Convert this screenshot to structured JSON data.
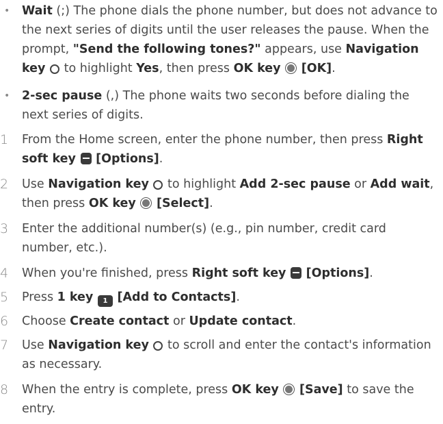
{
  "bullets": [
    {
      "term": "Wait",
      "t1": " (;) The phone dials the phone number, but does not advance to the next series of digits until the user releases the pause. When the prompt, ",
      "prompt": "\"Send the following tones?\"",
      "t2": " appears, use ",
      "nav_key": "Navigation key",
      "t3": " to highlight ",
      "yes": "Yes",
      "t4": ", then press ",
      "ok_key": "OK key",
      "ok_action": "[OK]",
      "t5": "."
    },
    {
      "term": "2-sec pause",
      "t1": " (,) The phone waits two seconds before dialing the next series of digits."
    }
  ],
  "steps": {
    "s1": {
      "num": "1",
      "t1": "From the Home screen, enter the phone number, then press ",
      "key": "Right soft key",
      "action": "[Options]",
      "t2": "."
    },
    "s2": {
      "num": "2",
      "t1": "Use ",
      "key": "Navigation key",
      "t2": " to highlight ",
      "opt1": "Add 2-sec pause",
      "t3": " or ",
      "opt2": "Add wait",
      "t4": ", then press ",
      "ok_key": "OK key",
      "ok_action": "[Select]",
      "t5": "."
    },
    "s3": {
      "num": "3",
      "t1": "Enter the additional number(s) (e.g., pin number, credit card number, etc.)."
    },
    "s4": {
      "num": "4",
      "t1": "When you're finished, press ",
      "key": "Right soft key",
      "action": "[Options]",
      "t2": "."
    },
    "s5": {
      "num": "5",
      "t1": "Press ",
      "key": "1 key",
      "key_glyph": "1",
      "action": "[Add to Contacts]",
      "t2": "."
    },
    "s6": {
      "num": "6",
      "t1": "Choose ",
      "opt1": "Create contact",
      "t2": " or ",
      "opt2": "Update contact",
      "t3": "."
    },
    "s7": {
      "num": "7",
      "t1": "Use ",
      "key": "Navigation key",
      "t2": " to scroll and enter the contact's information as necessary."
    },
    "s8": {
      "num": "8",
      "t1": "When the entry is complete, press ",
      "key": "OK key",
      "action": "[Save]",
      "t2": " to save the entry."
    }
  },
  "icons": {
    "navigation_key": "navigation-key-icon",
    "ok_key": "ok-key-icon",
    "right_soft_key": "right-soft-key-icon",
    "one_key": "one-key-icon"
  }
}
